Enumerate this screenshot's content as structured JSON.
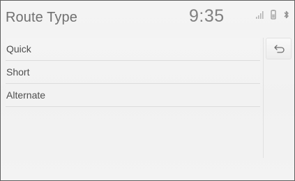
{
  "header": {
    "title": "Route Type",
    "time": "9:35",
    "status_icons": [
      "signal-icon",
      "battery-icon",
      "bluetooth-icon"
    ]
  },
  "menu": {
    "items": [
      {
        "label": "Quick"
      },
      {
        "label": "Short"
      },
      {
        "label": "Alternate"
      }
    ]
  },
  "controls": {
    "back_icon": "return-arrow-icon"
  },
  "colors": {
    "background": "#f2f2f2",
    "text": "#4e4e4e",
    "title": "#707070",
    "divider": "#dcdcdc"
  }
}
